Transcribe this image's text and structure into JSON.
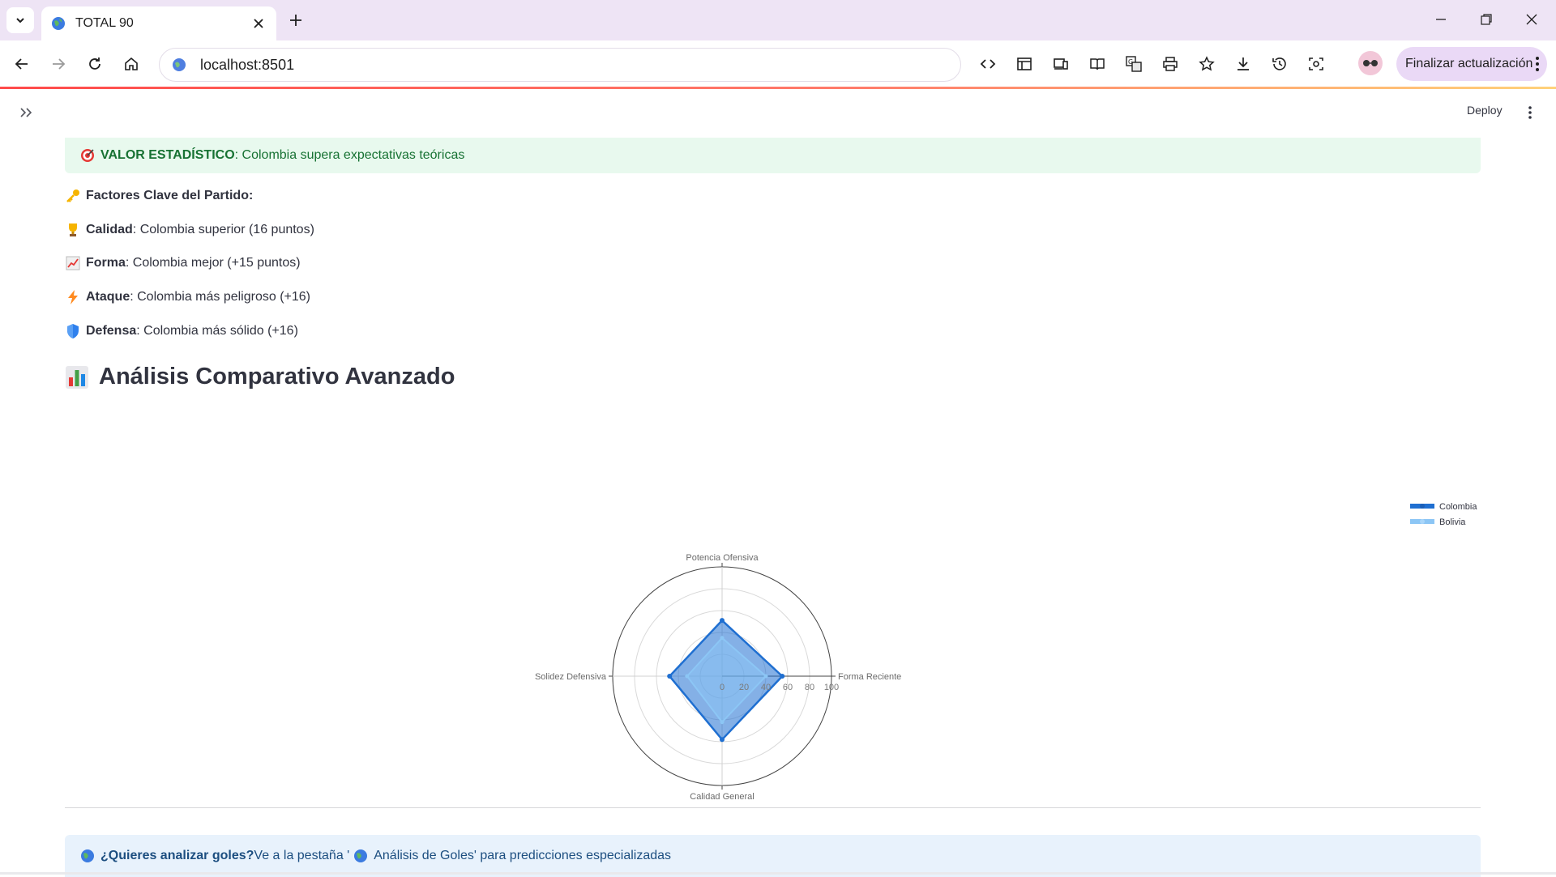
{
  "browser": {
    "tab_title": "TOTAL 90",
    "url": "localhost:8501",
    "update_button": "Finalizar actualización"
  },
  "app": {
    "deploy_label": "Deploy",
    "success": {
      "label": "VALOR ESTADÍSTICO",
      "text": ": Colombia supera expectativas teóricas"
    },
    "factors": {
      "heading": "Factores Clave del Partido:",
      "items": [
        {
          "label": "Calidad",
          "text": ": Colombia superior (16 puntos)",
          "icon": "trophy-icon"
        },
        {
          "label": "Forma",
          "text": ": Colombia mejor (+15 puntos)",
          "icon": "chart-up-icon"
        },
        {
          "label": "Ataque",
          "text": ": Colombia más peligroso (+16)",
          "icon": "lightning-icon"
        },
        {
          "label": "Defensa",
          "text": ": Colombia más sólido (+16)",
          "icon": "shield-icon"
        }
      ]
    },
    "section_title": "Análisis Comparativo Avanzado",
    "info": {
      "label": "¿Quieres analizar goles?",
      "text_before": " Ve a la pestaña '",
      "text_after": " Análisis de Goles' para predicciones especializadas"
    }
  },
  "chart_data": {
    "type": "radar",
    "axes": [
      "Potencia Ofensiva",
      "Forma Reciente",
      "Calidad General",
      "Solidez Defensiva"
    ],
    "radial_ticks": [
      "0",
      "20",
      "40",
      "60",
      "80",
      "100"
    ],
    "radial_range": [
      0,
      100
    ],
    "series": [
      {
        "name": "Colombia",
        "values": [
          51,
          55,
          58,
          48
        ],
        "color": "#1f6fd1"
      },
      {
        "name": "Bolivia",
        "values": [
          35,
          40,
          42,
          32
        ],
        "color": "#8cc6f5"
      }
    ],
    "legend_position": "top-right",
    "grid": true
  }
}
